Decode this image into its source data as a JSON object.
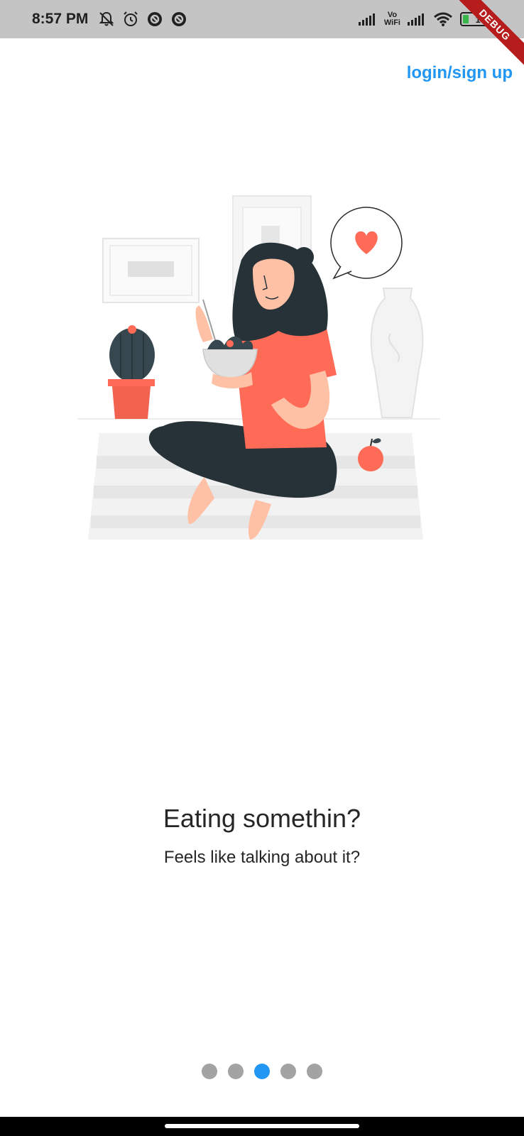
{
  "status_bar": {
    "time": "8:57 PM",
    "left_icons": [
      "mute-notifications-icon",
      "alarm-icon",
      "app-notification-icon",
      "app-notification-icon"
    ],
    "right_icons": [
      "signal-icon",
      "vowifi-icon",
      "signal-icon",
      "wifi-icon",
      "battery-icon"
    ],
    "vowifi_top": "Vo",
    "vowifi_bottom": "WiFi",
    "battery_level": "16",
    "battery_color": "#39b54a"
  },
  "debug_banner": "DEBUG",
  "header": {
    "login_label": "login/sign up",
    "link_color": "#2196f3"
  },
  "onboarding": {
    "illustration": "woman-eating-salad-illustration",
    "title": "Eating somethin?",
    "subtitle": "Feels like talking about it?"
  },
  "pager": {
    "total": 5,
    "current": 3,
    "active_color": "#2196f3",
    "inactive_color": "#a3a3a3"
  }
}
